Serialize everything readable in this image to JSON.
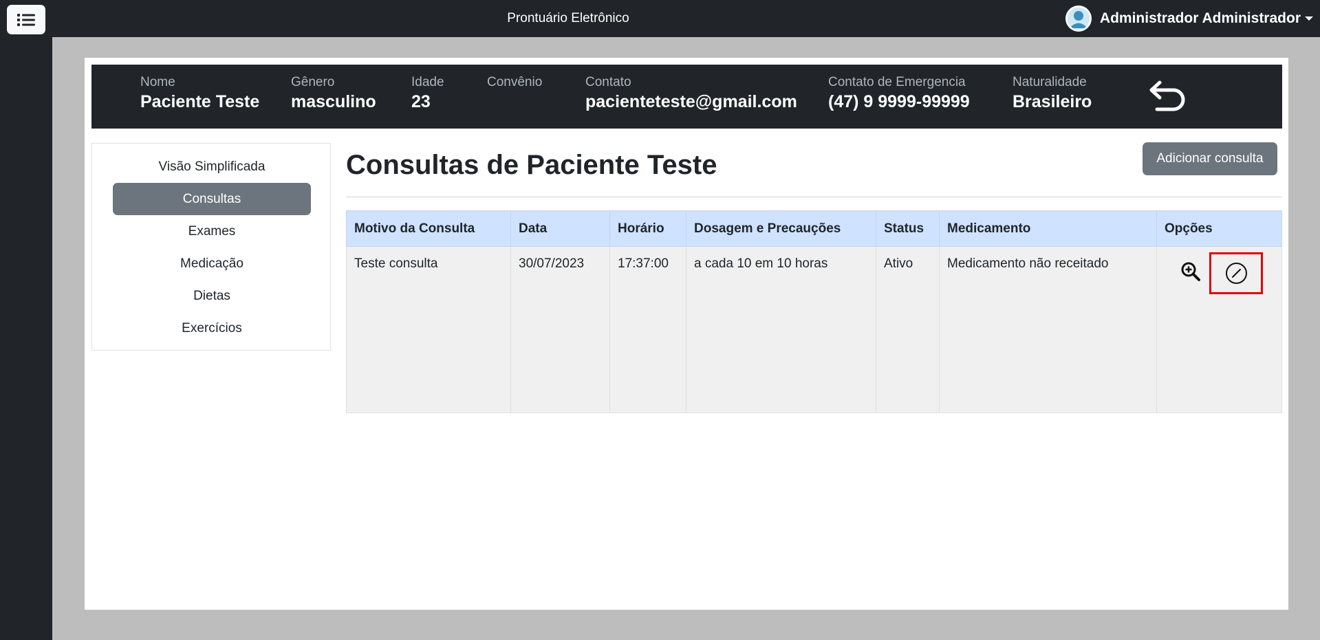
{
  "app": {
    "title": "Prontuário Eletrônico"
  },
  "user": {
    "name": "Administrador Administrador"
  },
  "patient": {
    "fields": [
      {
        "label": "Nome",
        "value": "Paciente Teste"
      },
      {
        "label": "Gênero",
        "value": "masculino"
      },
      {
        "label": "Idade",
        "value": "23"
      },
      {
        "label": "Convênio",
        "value": ""
      },
      {
        "label": "Contato",
        "value": "pacienteteste@gmail.com"
      },
      {
        "label": "Contato de Emergencia",
        "value": "(47) 9 9999-99999"
      },
      {
        "label": "Naturalidade",
        "value": "Brasileiro"
      }
    ]
  },
  "sidebar": {
    "items": [
      {
        "label": "Visão Simplificada"
      },
      {
        "label": "Consultas"
      },
      {
        "label": "Exames"
      },
      {
        "label": "Medicação"
      },
      {
        "label": "Dietas"
      },
      {
        "label": "Exercícios"
      }
    ],
    "active": "Consultas"
  },
  "main": {
    "title": "Consultas de Paciente Teste",
    "add_button": "Adicionar consulta"
  },
  "table": {
    "headers": [
      "Motivo da Consulta",
      "Data",
      "Horário",
      "Dosagem e Precauções",
      "Status",
      "Medicamento",
      "Opções"
    ],
    "rows": [
      [
        "Teste consulta",
        "30/07/2023",
        "17:37:00",
        "a cada 10 em 10 horas",
        "Ativo",
        "Medicamento não receitado"
      ]
    ]
  },
  "icons": {
    "menu": "list-icon",
    "avatar": "user-avatar-icon",
    "back": "return-arrow-icon",
    "view": "zoom-in-icon",
    "cancel": "slash-circle-icon"
  },
  "colors": {
    "navbar": "#212529",
    "frame": "#bdbdbd",
    "active_nav": "#6c757d",
    "table_header": "#cfe2ff",
    "highlight": "#e00000"
  }
}
